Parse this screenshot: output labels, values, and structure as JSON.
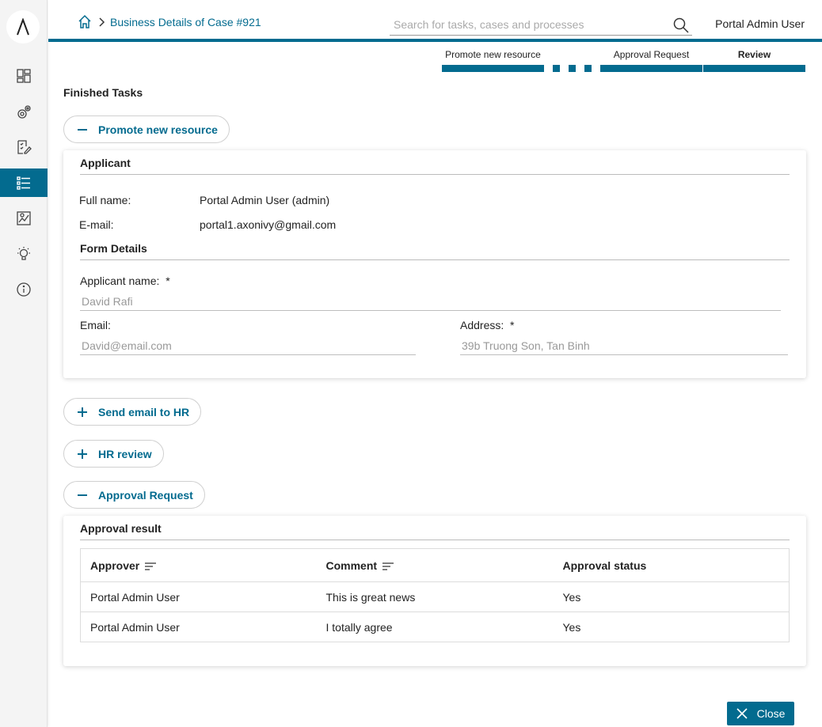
{
  "sidebar": {
    "logo": "axon-ivy-logo",
    "items": [
      {
        "icon": "dashboard-icon",
        "active": false
      },
      {
        "icon": "processes-gear-icon",
        "active": false
      },
      {
        "icon": "tasks-checklist-icon",
        "active": false
      },
      {
        "icon": "cases-list-icon",
        "active": true
      },
      {
        "icon": "statistics-chart-icon",
        "active": false
      },
      {
        "icon": "ideas-lightbulb-icon",
        "active": false
      },
      {
        "icon": "info-icon",
        "active": false
      }
    ]
  },
  "topbar": {
    "breadcrumb": "Business Details of Case #921",
    "search_placeholder": "Search for tasks, cases and processes",
    "user": "Portal Admin User"
  },
  "stepper": {
    "steps": [
      "Promote new resource",
      "Approval Request",
      "Review"
    ],
    "active_step": "Review"
  },
  "main": {
    "section_title": "Finished Tasks",
    "tasks": [
      {
        "label": "Promote new resource",
        "expanded": true
      },
      {
        "label": "Send email to HR",
        "expanded": false
      },
      {
        "label": "HR review",
        "expanded": false
      },
      {
        "label": "Approval Request",
        "expanded": true
      }
    ],
    "promote": {
      "applicant_heading": "Applicant",
      "full_name_label": "Full name:",
      "full_name_value": "Portal Admin User (admin)",
      "email_label": "E-mail:",
      "email_value": "portal1.axonivy@gmail.com",
      "form_heading": "Form Details",
      "applicant_name_label": "Applicant name:",
      "applicant_name_value": "David Rafi",
      "email_field_label": "Email:",
      "email_field_value": "David@email.com",
      "address_label": "Address:",
      "address_value": "39b Truong Son, Tan Binh",
      "required_mark": "*"
    },
    "approval": {
      "heading": "Approval result",
      "columns": [
        "Approver",
        "Comment",
        "Approval status"
      ],
      "rows": [
        {
          "approver": "Portal Admin User",
          "comment": "This is great news",
          "status": "Yes"
        },
        {
          "approver": "Portal Admin User",
          "comment": "I totally agree",
          "status": "Yes"
        }
      ]
    },
    "close_label": "Close"
  },
  "colors": {
    "accent": "#036b8f"
  }
}
